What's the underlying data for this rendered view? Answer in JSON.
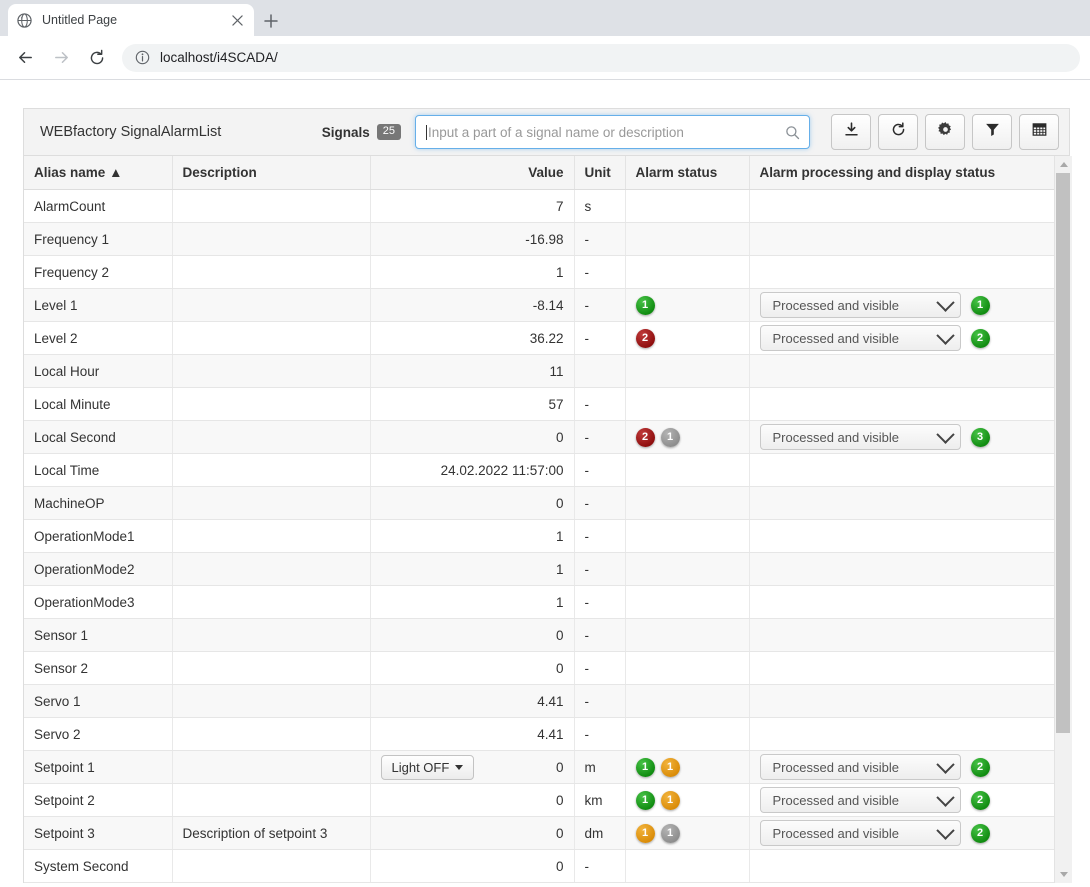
{
  "browser": {
    "tab": {
      "title": "Untitled Page",
      "favicon_icon": "globe-icon",
      "close_icon": "close-icon"
    },
    "new_tab_icon": "plus-icon",
    "nav": {
      "back_icon": "arrow-left-icon",
      "forward_icon": "arrow-right-icon",
      "reload_icon": "reload-icon"
    },
    "omnibox": {
      "info_icon": "info-circle-icon",
      "url": "localhost/i4SCADA/"
    }
  },
  "widget": {
    "title": "WEBfactory SignalAlarmList",
    "signals_label": "Signals",
    "signals_count": "25",
    "search": {
      "placeholder": "Input a part of a signal name or description",
      "value": "",
      "icon": "search-icon"
    },
    "tools": [
      {
        "name": "export-download-button",
        "icon": "download-icon",
        "glyph": "download"
      },
      {
        "name": "refresh-button",
        "icon": "refresh-icon",
        "glyph": "refresh"
      },
      {
        "name": "settings-button",
        "icon": "gear-icon",
        "glyph": "gear"
      },
      {
        "name": "filter-button",
        "icon": "filter-icon",
        "glyph": "filter"
      },
      {
        "name": "columns-grid-button",
        "icon": "grid-icon",
        "glyph": "grid"
      }
    ]
  },
  "table": {
    "columns": [
      {
        "key": "alias",
        "label": "Alias name",
        "sort": "▲"
      },
      {
        "key": "description",
        "label": "Description"
      },
      {
        "key": "value",
        "label": "Value"
      },
      {
        "key": "unit",
        "label": "Unit"
      },
      {
        "key": "alarm_status",
        "label": "Alarm status"
      },
      {
        "key": "processing",
        "label": "Alarm processing and display status"
      }
    ],
    "select_value": "Processed and visible",
    "rows": [
      {
        "alias": "AlarmCount",
        "description": "",
        "value": "7",
        "unit": "s",
        "alarm_badges": [],
        "processing": false,
        "count_badges": []
      },
      {
        "alias": "Frequency 1",
        "description": "",
        "value": "-16.98",
        "unit": "-",
        "alarm_badges": [],
        "processing": false,
        "count_badges": []
      },
      {
        "alias": "Frequency 2",
        "description": "",
        "value": "1",
        "unit": "-",
        "alarm_badges": [],
        "processing": false,
        "count_badges": []
      },
      {
        "alias": "Level 1",
        "description": "",
        "value": "-8.14",
        "unit": "-",
        "alarm_badges": [
          {
            "color": "green",
            "text": "1"
          }
        ],
        "processing": true,
        "count_badges": [
          {
            "color": "green",
            "text": "1"
          }
        ]
      },
      {
        "alias": "Level 2",
        "description": "",
        "value": "36.22",
        "unit": "-",
        "alarm_badges": [
          {
            "color": "red",
            "text": "2"
          }
        ],
        "processing": true,
        "count_badges": [
          {
            "color": "green",
            "text": "2"
          }
        ]
      },
      {
        "alias": "Local Hour",
        "description": "",
        "value": "11",
        "unit": "",
        "alarm_badges": [],
        "processing": false,
        "count_badges": []
      },
      {
        "alias": "Local Minute",
        "description": "",
        "value": "57",
        "unit": "-",
        "alarm_badges": [],
        "processing": false,
        "count_badges": []
      },
      {
        "alias": "Local Second",
        "description": "",
        "value": "0",
        "unit": "-",
        "alarm_badges": [
          {
            "color": "red",
            "text": "2"
          },
          {
            "color": "gray",
            "text": "1"
          }
        ],
        "processing": true,
        "count_badges": [
          {
            "color": "green",
            "text": "3"
          }
        ]
      },
      {
        "alias": "Local Time",
        "description": "",
        "value": "24.02.2022 11:57:00",
        "unit": "-",
        "alarm_badges": [],
        "processing": false,
        "count_badges": []
      },
      {
        "alias": "MachineOP",
        "description": "",
        "value": "0",
        "unit": "-",
        "alarm_badges": [],
        "processing": false,
        "count_badges": []
      },
      {
        "alias": "OperationMode1",
        "description": "",
        "value": "1",
        "unit": "-",
        "alarm_badges": [],
        "processing": false,
        "count_badges": []
      },
      {
        "alias": "OperationMode2",
        "description": "",
        "value": "1",
        "unit": "-",
        "alarm_badges": [],
        "processing": false,
        "count_badges": []
      },
      {
        "alias": "OperationMode3",
        "description": "",
        "value": "1",
        "unit": "-",
        "alarm_badges": [],
        "processing": false,
        "count_badges": []
      },
      {
        "alias": "Sensor 1",
        "description": "",
        "value": "0",
        "unit": "-",
        "alarm_badges": [],
        "processing": false,
        "count_badges": []
      },
      {
        "alias": "Sensor 2",
        "description": "",
        "value": "0",
        "unit": "-",
        "alarm_badges": [],
        "processing": false,
        "count_badges": []
      },
      {
        "alias": "Servo 1",
        "description": "",
        "value": "4.41",
        "unit": "-",
        "alarm_badges": [],
        "processing": false,
        "count_badges": []
      },
      {
        "alias": "Servo 2",
        "description": "",
        "value": "4.41",
        "unit": "-",
        "alarm_badges": [],
        "processing": false,
        "count_badges": []
      },
      {
        "alias": "Setpoint 1",
        "description": "",
        "value": "0",
        "unit": "m",
        "button": "Light OFF",
        "alarm_badges": [
          {
            "color": "green",
            "text": "1"
          },
          {
            "color": "orange",
            "text": "1"
          }
        ],
        "processing": true,
        "count_badges": [
          {
            "color": "green",
            "text": "2"
          }
        ]
      },
      {
        "alias": "Setpoint 2",
        "description": "",
        "value": "0",
        "unit": "km",
        "alarm_badges": [
          {
            "color": "green",
            "text": "1"
          },
          {
            "color": "orange",
            "text": "1"
          }
        ],
        "processing": true,
        "count_badges": [
          {
            "color": "green",
            "text": "2"
          }
        ]
      },
      {
        "alias": "Setpoint 3",
        "description": "Description of setpoint 3",
        "value": "0",
        "unit": "dm",
        "alarm_badges": [
          {
            "color": "orange",
            "text": "1"
          },
          {
            "color": "gray",
            "text": "1"
          }
        ],
        "processing": true,
        "count_badges": [
          {
            "color": "green",
            "text": "2"
          }
        ]
      },
      {
        "alias": "System Second",
        "description": "",
        "value": "0",
        "unit": "-",
        "alarm_badges": [],
        "processing": false,
        "count_badges": []
      }
    ]
  },
  "scrollbar": {
    "up_icon": "triangle-up-icon",
    "down_icon": "triangle-down-icon"
  }
}
